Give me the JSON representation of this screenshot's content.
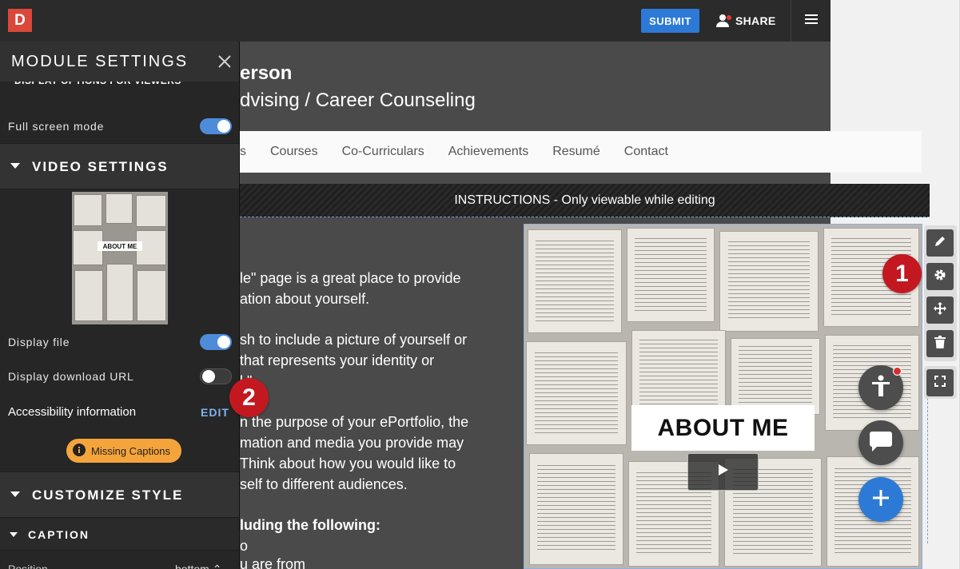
{
  "topbar": {
    "logo_letter": "D",
    "submit_label": "SUBMIT",
    "share_label": "SHARE"
  },
  "portfolio": {
    "name_fragment": "erson",
    "subtitle_fragment": "dvising / Career Counseling",
    "nav_items": [
      "s",
      "Courses",
      "Co-Curriculars",
      "Achievements",
      "Resumé",
      "Contact"
    ],
    "instructions": "INSTRUCTIONS - Only viewable while editing",
    "body_lines": [
      "le\" page is a great place to provide",
      "ation about yourself.",
      "sh to include a picture of yourself or",
      "that represents your identity or",
      "l.\"",
      "n the purpose of your ePortfolio, the",
      "mation and media you provide may",
      "Think about how you would like to",
      "self to different audiences.",
      "luding the following:",
      "o",
      "u are from"
    ],
    "video_overlay_text": "ABOUT ME"
  },
  "panel": {
    "title": "MODULE SETTINGS",
    "cut_section_label": "DISPLAY OPTIONS FOR VIEWERS",
    "full_screen_label": "Full screen mode",
    "full_screen_on": true,
    "video_settings_label": "VIDEO SETTINGS",
    "thumbnail_text": "ABOUT ME",
    "display_file_label": "Display file",
    "display_file_on": true,
    "display_download_label": "Display download URL",
    "display_download_on": false,
    "accessibility_label": "Accessibility information",
    "edit_label": "EDIT",
    "missing_captions_label": "Missing Captions",
    "customize_style_label": "CUSTOMIZE STYLE",
    "caption_label": "CAPTION",
    "position_label": "Position",
    "position_value": "bottom ⌃"
  },
  "callouts": {
    "one": "1",
    "two": "2"
  },
  "colors": {
    "accent_blue": "#2d7ad6",
    "callout_red": "#c41821",
    "warning_orange": "#f5a43c"
  }
}
